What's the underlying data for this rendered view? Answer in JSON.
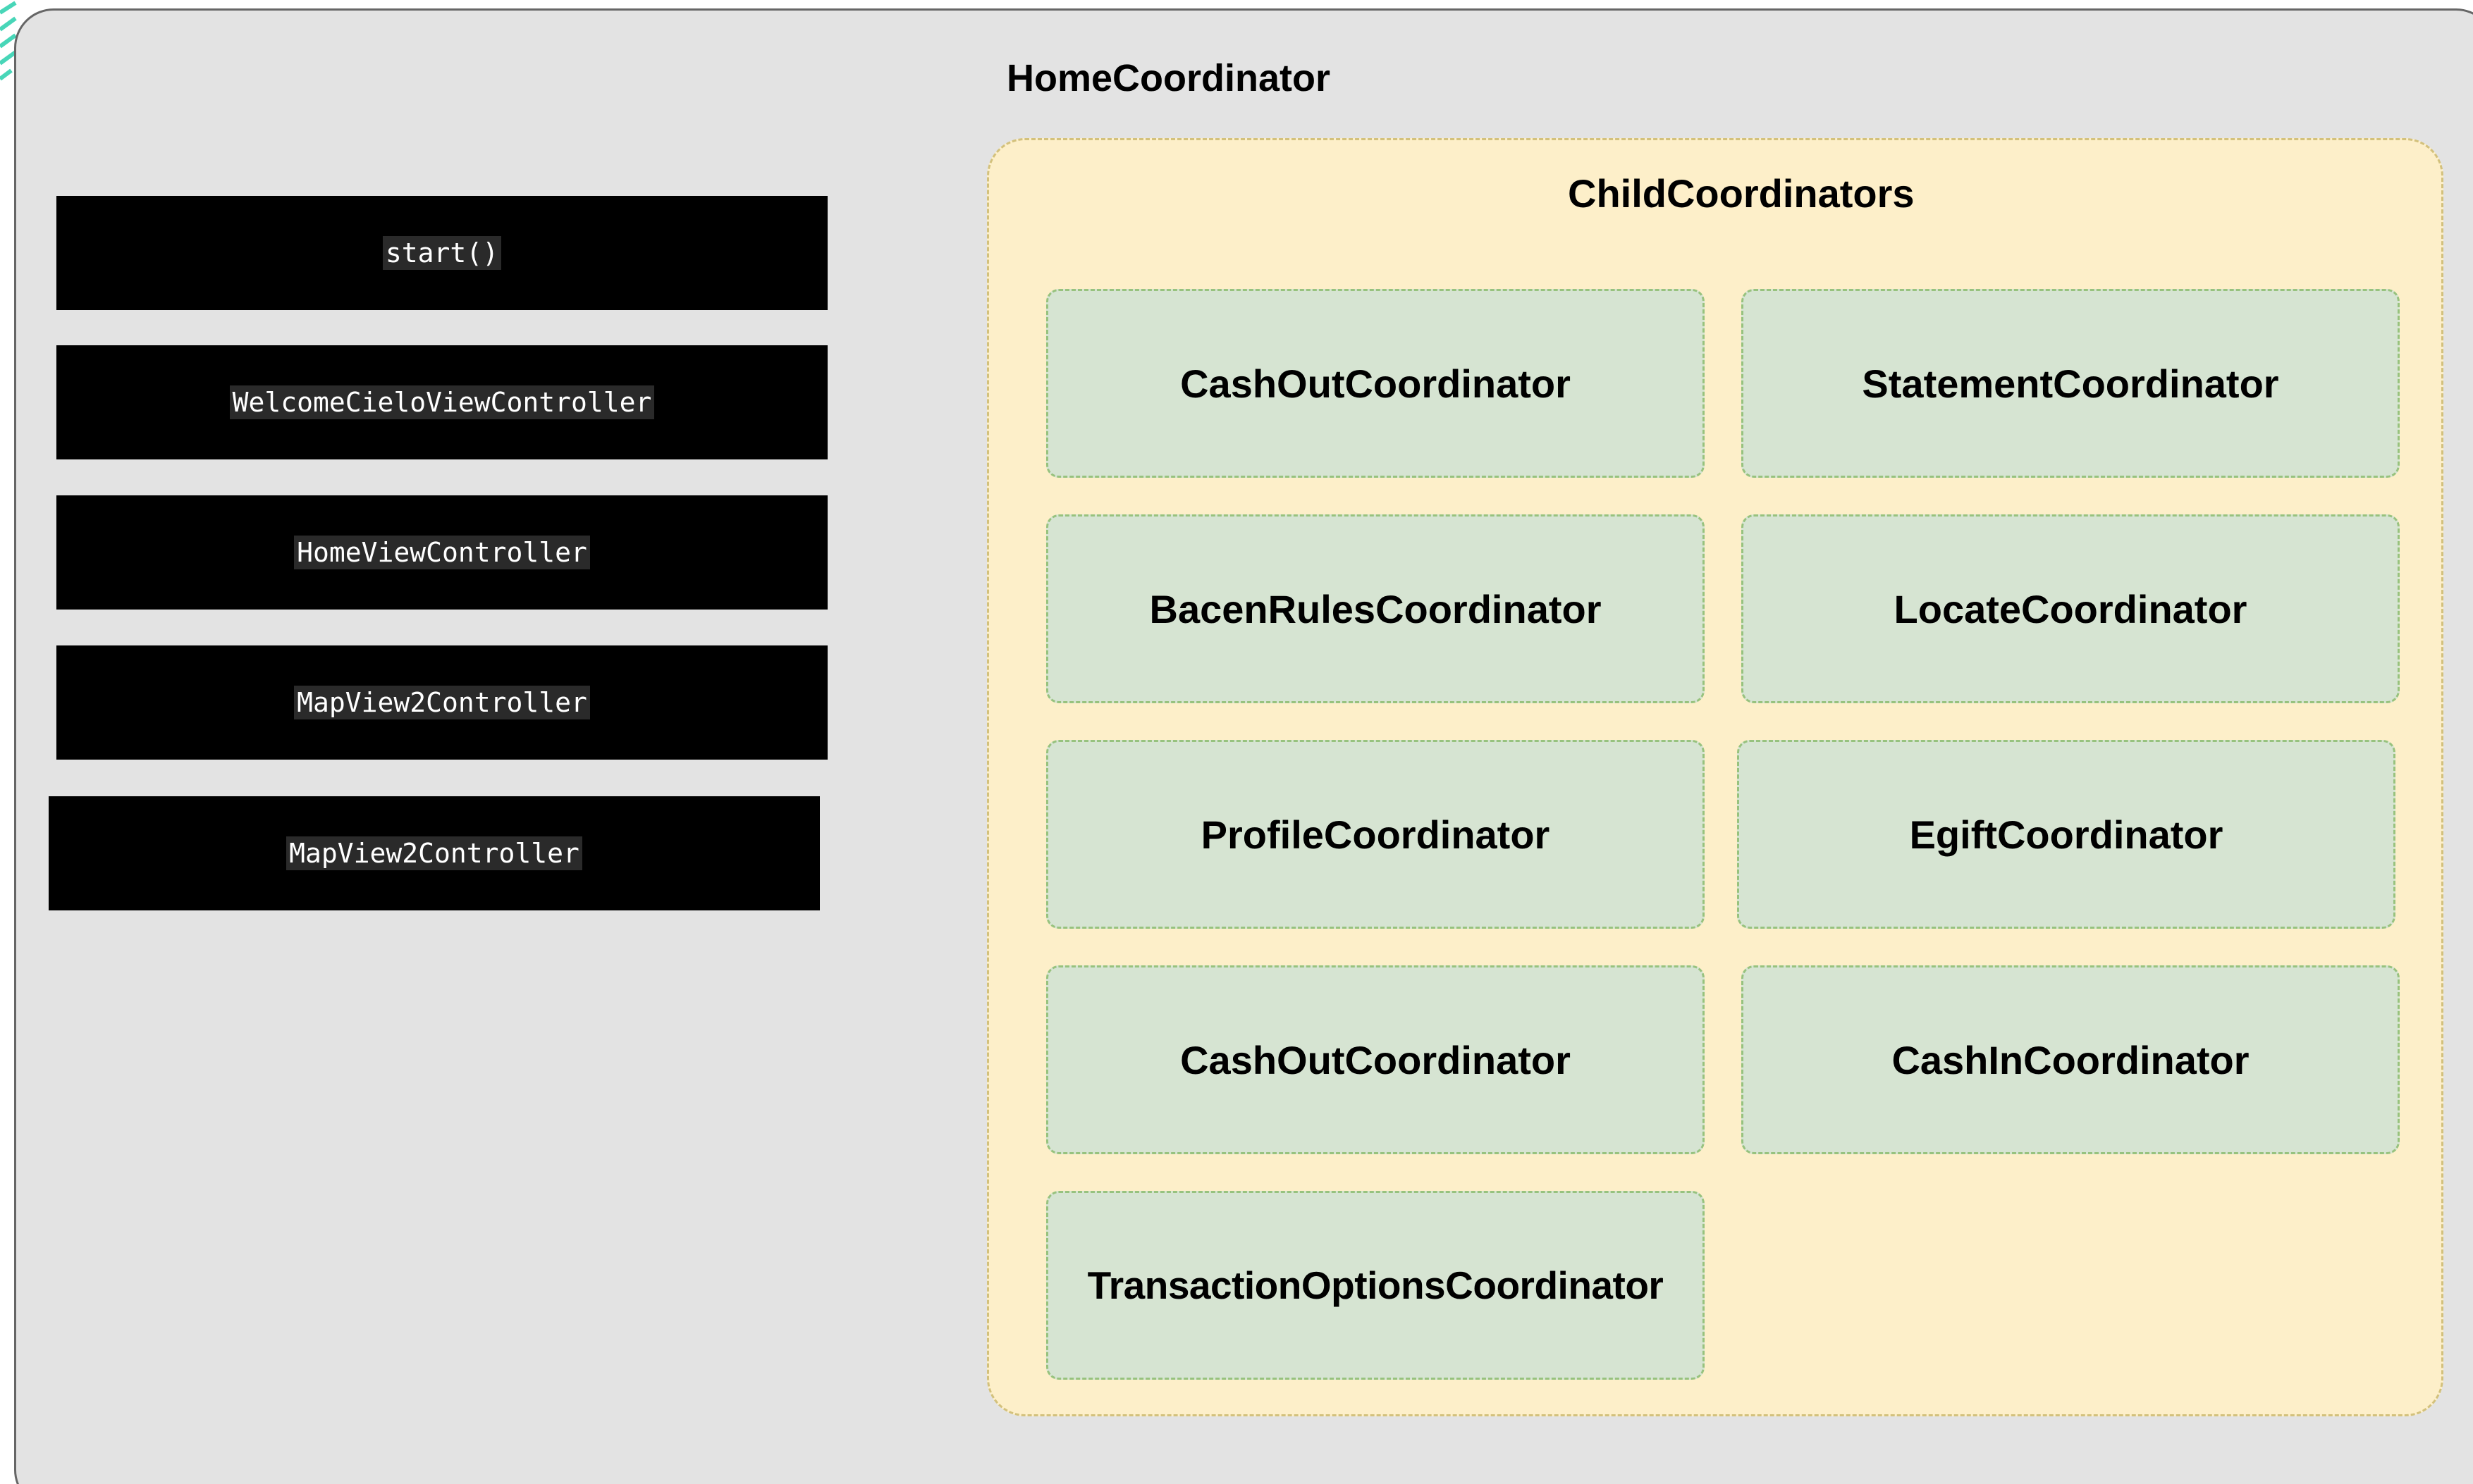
{
  "home_coordinator": {
    "title": "HomeCoordinator"
  },
  "methods": [
    {
      "label": "start()"
    },
    {
      "label": "WelcomeCieloViewController"
    },
    {
      "label": "HomeViewController"
    },
    {
      "label": "MapView2Controller"
    },
    {
      "label": "MapView2Controller"
    }
  ],
  "child_coordinators": {
    "title": "ChildCoordinators",
    "items": [
      {
        "label": "CashOutCoordinator"
      },
      {
        "label": "StatementCoordinator"
      },
      {
        "label": "BacenRulesCoordinator"
      },
      {
        "label": "LocateCoordinator"
      },
      {
        "label": "ProfileCoordinator"
      },
      {
        "label": "EgiftCoordinator"
      },
      {
        "label": "CashOutCoordinator"
      },
      {
        "label": "CashInCoordinator"
      },
      {
        "label": "TransactionOptionsCoordinator"
      }
    ]
  },
  "colors": {
    "outer_background": "#e3e3e3",
    "outer_border": "#666666",
    "method_box": "#000000",
    "method_text": "#ffffff",
    "group_fill": "#fdefc9",
    "group_border": "#d3c17c",
    "coordinator_fill": "#d6e4d2",
    "coordinator_border": "#97c27e",
    "corner_accent": "#48d6b8"
  }
}
